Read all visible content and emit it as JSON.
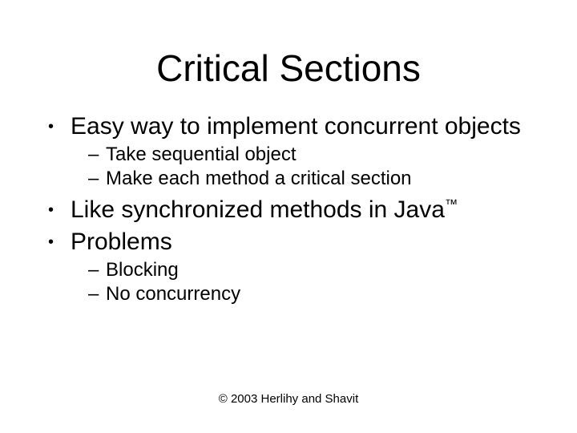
{
  "title": "Critical Sections",
  "bullets": {
    "b1": "Easy way to implement concurrent objects",
    "b1_sub1": "Take sequential object",
    "b1_sub2": "Make each method a critical section",
    "b2_prefix": "Like synchronized methods in Java",
    "b2_tm": "™",
    "b3": "Problems",
    "b3_sub1": "Blocking",
    "b3_sub2": "No concurrency"
  },
  "footer": "© 2003 Herlihy and Shavit"
}
